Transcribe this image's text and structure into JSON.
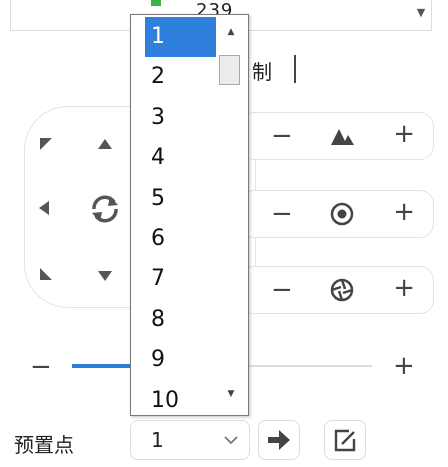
{
  "top_select": {
    "value": "239",
    "prefix": "..."
  },
  "tab_label": "制",
  "ptz": {
    "directions": [
      "up-left",
      "up",
      "left",
      "auto-rotate",
      "down-left",
      "down"
    ]
  },
  "controls": [
    {
      "name": "zoom",
      "icon": "mountain-icon"
    },
    {
      "name": "focus",
      "icon": "target-icon"
    },
    {
      "name": "iris",
      "icon": "aperture-icon"
    }
  ],
  "symbols": {
    "minus": "−",
    "plus": "+"
  },
  "slider": {
    "value_fraction": 0.2,
    "accent": "#2b7fd8"
  },
  "preset": {
    "label": "预置点",
    "value": "1",
    "options": [
      "1",
      "2",
      "3",
      "4",
      "5",
      "6",
      "7",
      "8",
      "9",
      "10"
    ],
    "selected_index": 0
  },
  "dropdown_accent": "#2f7fdd"
}
